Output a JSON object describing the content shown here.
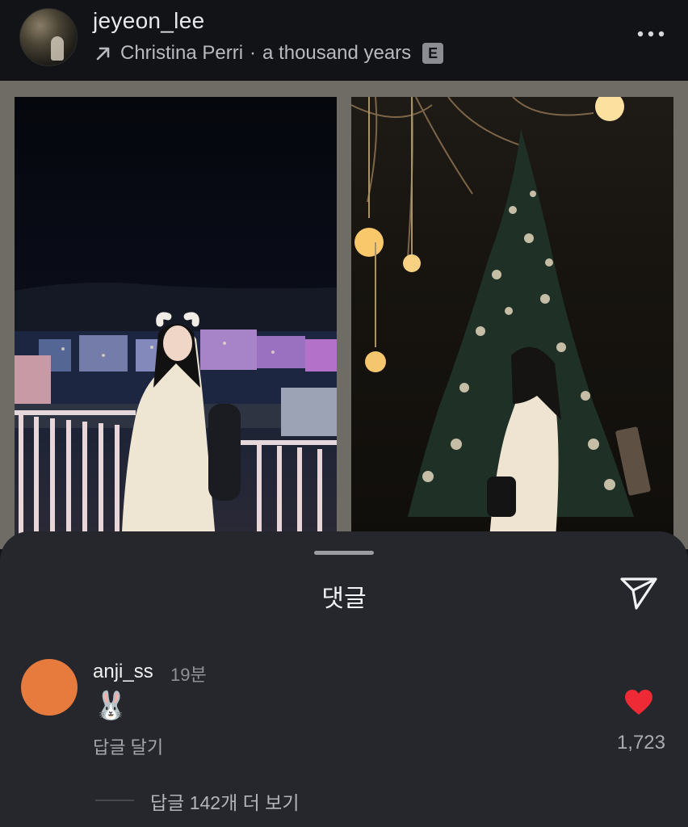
{
  "post": {
    "username": "jeyeon_lee",
    "music": {
      "artist": "Christina Perri",
      "separator": "·",
      "song": "a thousand years",
      "explicit_badge": "E"
    },
    "icons": {
      "music_link": "arrow-up-right-icon",
      "more": "more-horizontal-icon"
    }
  },
  "photos": [
    {
      "description_name": "photo-left"
    },
    {
      "description_name": "photo-right"
    }
  ],
  "comments_sheet": {
    "title": "댓글",
    "share_icon": "send-icon",
    "comment": {
      "username": "anji_ss",
      "time": "19분",
      "text": "🐰",
      "reply_label": "답글 달기",
      "like_count": "1,723",
      "avatar_color": "#e77b3d",
      "like_color": "#ed2a35"
    },
    "view_replies": "답글 142개 더 보기"
  }
}
